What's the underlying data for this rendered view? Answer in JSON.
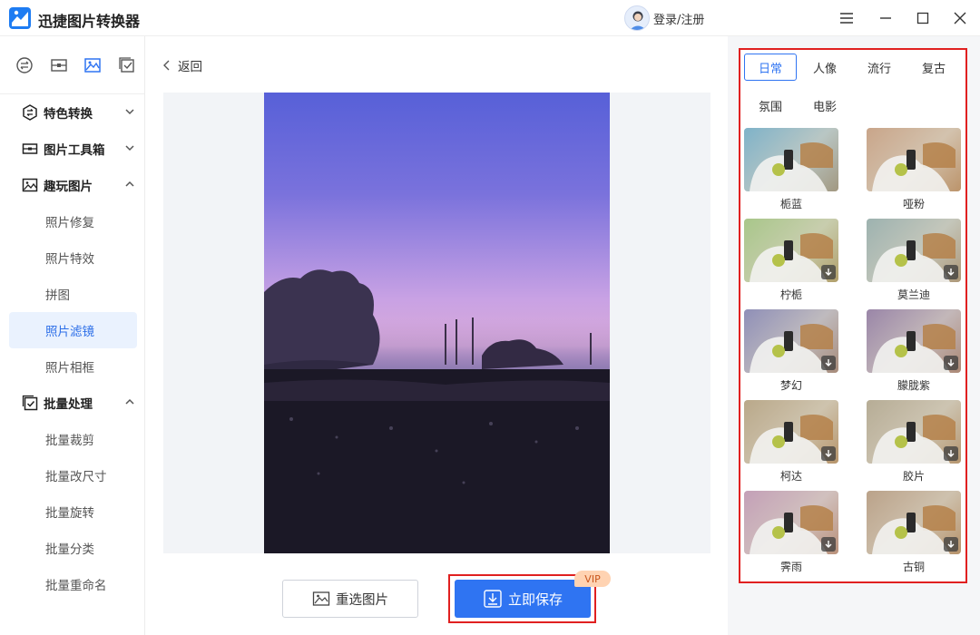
{
  "app": {
    "title": "迅捷图片转换器",
    "login_label": "登录/注册"
  },
  "sidebar": {
    "groups": [
      {
        "label": "特色转换",
        "icon": "convert-icon",
        "expanded": false,
        "items": []
      },
      {
        "label": "图片工具箱",
        "icon": "toolbox-icon",
        "expanded": false,
        "items": []
      },
      {
        "label": "趣玩图片",
        "icon": "image-fun-icon",
        "expanded": true,
        "items": [
          "照片修复",
          "照片特效",
          "拼图",
          "照片滤镜",
          "照片相框"
        ]
      },
      {
        "label": "批量处理",
        "icon": "batch-icon",
        "expanded": true,
        "items": [
          "批量裁剪",
          "批量改尺寸",
          "批量旋转",
          "批量分类",
          "批量重命名"
        ]
      }
    ],
    "active_item": "照片滤镜"
  },
  "main": {
    "back_label": "返回",
    "reselect_label": "重选图片",
    "save_label": "立即保存",
    "vip_label": "VIP"
  },
  "filters": {
    "tabs": [
      "日常",
      "人像",
      "流行",
      "复古",
      "氛围",
      "电影"
    ],
    "active_tab": "日常",
    "items": [
      {
        "name": "栀蓝",
        "downloadable": false,
        "tint": "#7fb3c9"
      },
      {
        "name": "哑粉",
        "downloadable": false,
        "tint": "#c9a58a"
      },
      {
        "name": "柠栀",
        "downloadable": true,
        "tint": "#a8c78a"
      },
      {
        "name": "莫兰迪",
        "downloadable": true,
        "tint": "#9db3b0"
      },
      {
        "name": "梦幻",
        "downloadable": true,
        "tint": "#8f8fb8"
      },
      {
        "name": "朦胧紫",
        "downloadable": true,
        "tint": "#9a86a8"
      },
      {
        "name": "柯达",
        "downloadable": true,
        "tint": "#b9a88a"
      },
      {
        "name": "胶片",
        "downloadable": true,
        "tint": "#b6ad96"
      },
      {
        "name": "霁雨",
        "downloadable": true,
        "tint": "#c4a0b8"
      },
      {
        "name": "古铜",
        "downloadable": true,
        "tint": "#bba28a"
      }
    ]
  },
  "colors": {
    "accent": "#2f74f2",
    "highlight": "#e02020",
    "active_bg": "#eaf2fe"
  }
}
